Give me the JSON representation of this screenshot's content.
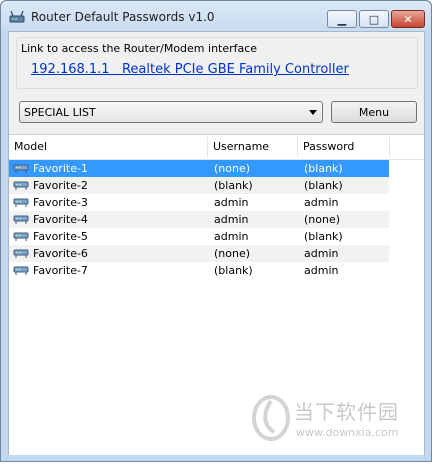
{
  "window": {
    "title": "Router Default Passwords v1.0",
    "minimize_glyph": "▁",
    "maximize_glyph": "□",
    "close_glyph": "✕"
  },
  "link_group": {
    "label": "Link to access the Router/Modem interface",
    "link_text": "192.168.1.1   Realtek PCIe GBE Family Controller"
  },
  "toolbar": {
    "list_select_value": "SPECIAL LIST",
    "menu_label": "Menu"
  },
  "table": {
    "columns": [
      "Model",
      "Username",
      "Password"
    ],
    "rows": [
      {
        "model": "Favorite-1",
        "username": "(none)",
        "password": "(blank)"
      },
      {
        "model": "Favorite-2",
        "username": "(blank)",
        "password": "(blank)"
      },
      {
        "model": "Favorite-3",
        "username": "admin",
        "password": "admin"
      },
      {
        "model": "Favorite-4",
        "username": "admin",
        "password": "(none)"
      },
      {
        "model": "Favorite-5",
        "username": "admin",
        "password": "(blank)"
      },
      {
        "model": "Favorite-6",
        "username": "(none)",
        "password": "admin"
      },
      {
        "model": "Favorite-7",
        "username": "(blank)",
        "password": "admin"
      }
    ],
    "selected_row_index": 0,
    "row_icon": "router-icon"
  },
  "watermark": {
    "text_cn": "当下软件园",
    "url": "www.downxia.com"
  },
  "colors": {
    "link": "#0033cc",
    "selection": "#3399ff",
    "close_button": "#c8452e"
  }
}
